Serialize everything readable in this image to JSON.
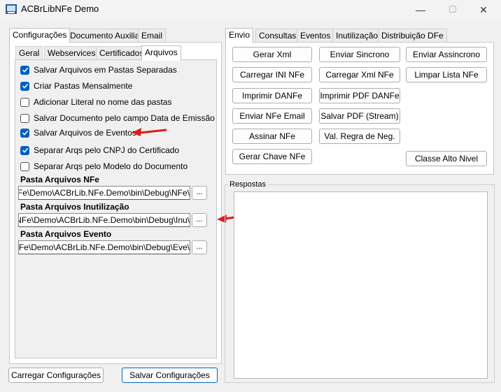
{
  "window": {
    "title": "ACBrLibNFe Demo",
    "minimize": "—",
    "maximize": "☐",
    "close": "✕"
  },
  "left_tabs": [
    "Configurações",
    "Documento Auxiliar",
    "Email"
  ],
  "sub_tabs": [
    "Geral",
    "Webservices",
    "Certificados",
    "Arquivos"
  ],
  "checkboxes": [
    {
      "label": "Salvar Arquivos em Pastas Separadas",
      "checked": true
    },
    {
      "label": "Criar Pastas Mensalmente",
      "checked": true
    },
    {
      "label": "Adicionar Literal no nome das pastas",
      "checked": false
    },
    {
      "label": "Salvar Documento pelo campo Data de Emissão",
      "checked": false
    },
    {
      "label": "Salvar Arquivos de Eventos",
      "checked": true
    },
    {
      "label": "Separar Arqs pelo CNPJ do Certificado",
      "checked": true
    },
    {
      "label": "Separar Arqs pelo Modelo do Documento",
      "checked": false
    }
  ],
  "folders": [
    {
      "label": "Pasta Arquivos NFe",
      "value": ":\\NFe\\Demo\\ACBrLib.NFe.Demo\\bin\\Debug\\NFe\\",
      "browse": "..."
    },
    {
      "label": "Pasta Arquivos Inutilização",
      "value": "#\\NFe\\Demo\\ACBrLib.NFe.Demo\\bin\\Debug\\Inu\\",
      "browse": "..."
    },
    {
      "label": "Pasta Arquivos Evento",
      "value": "!\\NFe\\Demo\\ACBrLib.NFe.Demo\\bin\\Debug\\Eve\\",
      "browse": "..."
    }
  ],
  "bottom_buttons": {
    "load": "Carregar Configurações",
    "save": "Salvar Configurações"
  },
  "right_tabs": [
    "Envio",
    "Consultas",
    "Eventos",
    "Inutilização",
    "Distribuição DFe"
  ],
  "action_buttons": {
    "gerar_xml": "Gerar Xml",
    "enviar_sincrono": "Enviar Sincrono",
    "enviar_assincrono": "Enviar Assincrono",
    "carregar_ini": "Carregar INI NFe",
    "carregar_xml": "Carregar Xml NFe",
    "limpar_lista": "Limpar Lista NFe",
    "imprimir_danfe": "Imprimir DANFe",
    "imprimir_pdf": "Imprimir PDF DANFe",
    "enviar_email": "Enviar NFe Email",
    "salvar_pdf": "Salvar PDF (Stream)",
    "assinar": "Assinar NFe",
    "val_regra": "Val. Regra de Neg.",
    "gerar_chave": "Gerar Chave NFe",
    "classe_alto_nivel": "Classe Alto Nivel"
  },
  "respostas_label": "Respostas",
  "colors": {
    "accent": "#0060c0",
    "arrow": "#e01b1b"
  }
}
